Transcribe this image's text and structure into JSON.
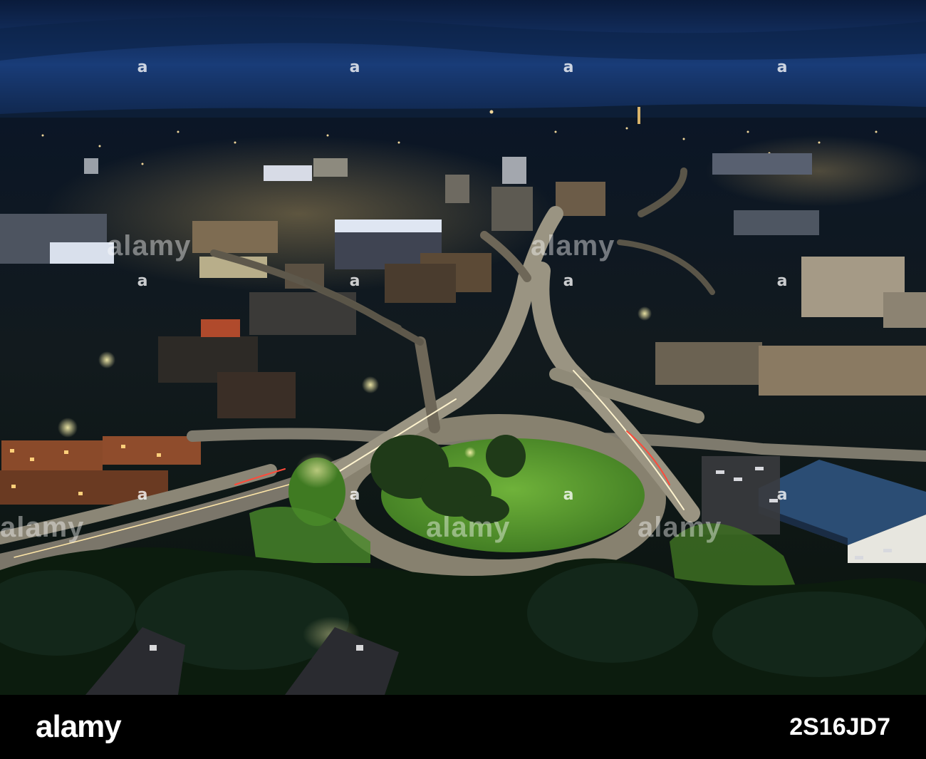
{
  "watermark": {
    "brand": "alamy",
    "tile_glyph": "a",
    "tile_rows": [
      [
        {
          "col": 0
        },
        {
          "col": 1
        },
        {
          "col": 2
        },
        {
          "col": 3
        }
      ],
      [
        {
          "col": 0
        },
        {
          "col": 1
        },
        {
          "col": 2
        },
        {
          "col": 3
        }
      ],
      [
        {
          "col": 0
        },
        {
          "col": 1
        },
        {
          "col": 2
        },
        {
          "col": 3
        }
      ]
    ]
  },
  "footer": {
    "logo_text": "alamy",
    "image_id": "2S16JD7"
  },
  "colors": {
    "sky_top": "#0a1d3f",
    "sky_blue": "#1a3f7a",
    "horizon": "#0f2850",
    "city_lights": "#f2c66a",
    "grass": "#5d9b2e",
    "road": "#7f7a6a",
    "trees": "#0c1e0f"
  }
}
